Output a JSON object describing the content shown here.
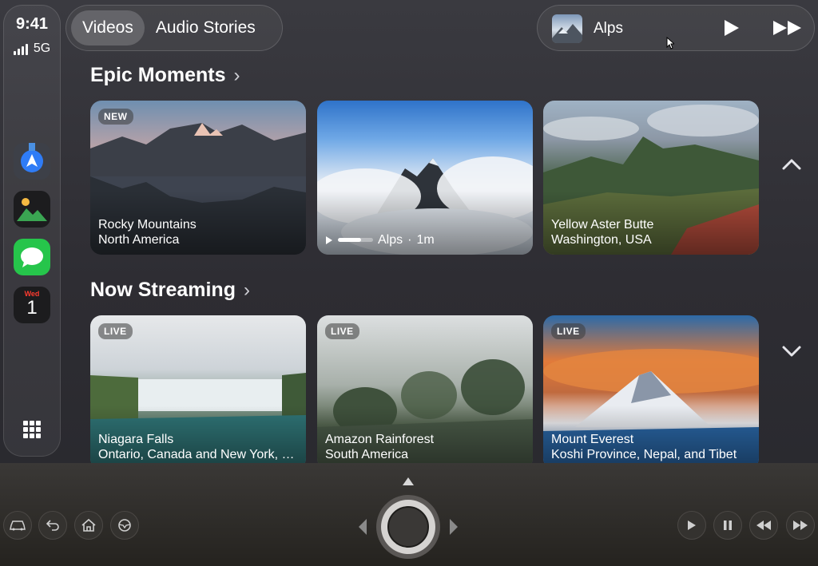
{
  "status": {
    "time": "9:41",
    "network": "5G"
  },
  "dock": {
    "apps": [
      {
        "name": "Maps"
      },
      {
        "name": "Photos"
      },
      {
        "name": "Messages"
      },
      {
        "name": "Calendar",
        "day": "Wed",
        "date": "1"
      }
    ]
  },
  "tabs": [
    {
      "label": "Videos",
      "active": true
    },
    {
      "label": "Audio Stories",
      "active": false
    }
  ],
  "now_playing": {
    "title": "Alps"
  },
  "sections": [
    {
      "title": "Epic Moments",
      "cards": [
        {
          "badge": "NEW",
          "line1": "Rocky Mountains",
          "line2": "North America"
        },
        {
          "title": "Alps",
          "separator": "·",
          "duration": "1m",
          "progress": 0.65
        },
        {
          "line1": "Yellow Aster Butte",
          "line2": "Washington, USA"
        }
      ]
    },
    {
      "title": "Now Streaming",
      "cards": [
        {
          "badge": "LIVE",
          "line1": "Niagara Falls",
          "line2": "Ontario, Canada and New York, USA"
        },
        {
          "badge": "LIVE",
          "line1": "Amazon Rainforest",
          "line2": "South America"
        },
        {
          "badge": "LIVE",
          "line1": "Mount Everest",
          "line2": "Koshi Province, Nepal, and Tibet"
        }
      ]
    }
  ],
  "colors": {
    "accent_green": "#26c54b",
    "calendar_red": "#ff3b30"
  }
}
